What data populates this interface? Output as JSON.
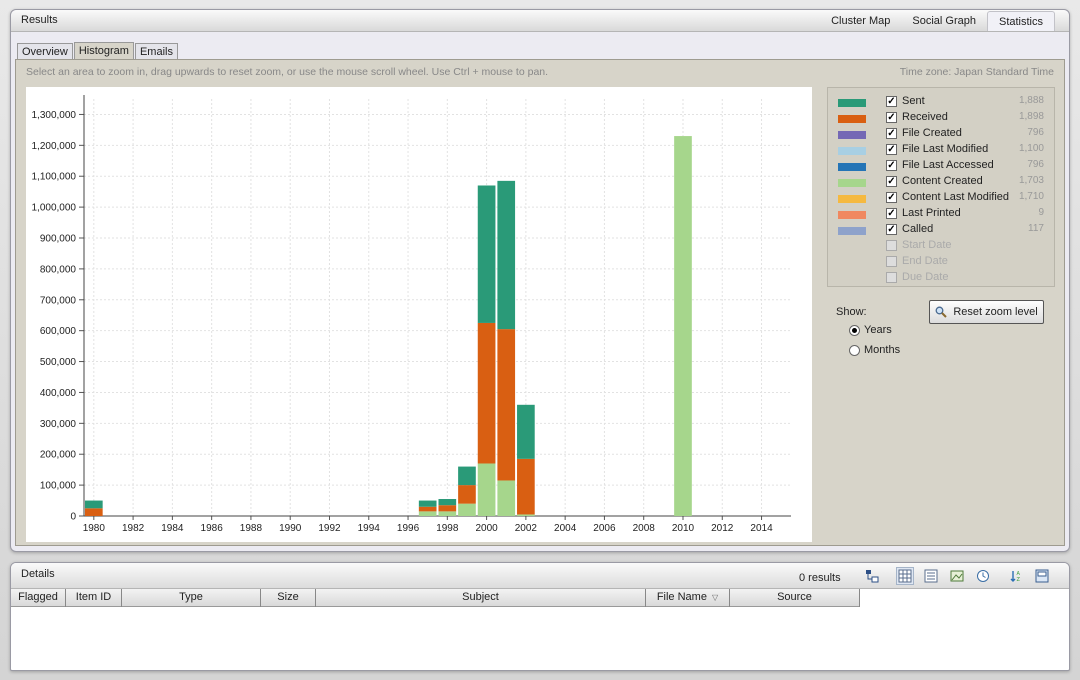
{
  "results": {
    "title": "Results",
    "top_tabs": [
      {
        "label": "Cluster Map",
        "active": false
      },
      {
        "label": "Social Graph",
        "active": false
      },
      {
        "label": "Statistics",
        "active": true
      }
    ],
    "sub_tabs": [
      {
        "label": "Overview",
        "active": false
      },
      {
        "label": "Histogram",
        "active": true
      },
      {
        "label": "Emails",
        "active": false
      }
    ],
    "hint": "Select an area to zoom in, drag upwards to reset zoom, or use the mouse scroll wheel. Use Ctrl + mouse to pan.",
    "timezone": "Time zone: Japan Standard Time"
  },
  "legend": [
    {
      "label": "Sent",
      "count": "1,888",
      "color": "#2a9a78",
      "checked": true,
      "enabled": true
    },
    {
      "label": "Received",
      "count": "1,898",
      "color": "#d95f12",
      "checked": true,
      "enabled": true
    },
    {
      "label": "File Created",
      "count": "796",
      "color": "#7468b5",
      "checked": true,
      "enabled": true
    },
    {
      "label": "File Last Modified",
      "count": "1,100",
      "color": "#a8cfe3",
      "checked": true,
      "enabled": true
    },
    {
      "label": "File Last Accessed",
      "count": "796",
      "color": "#2474b6",
      "checked": true,
      "enabled": true
    },
    {
      "label": "Content Created",
      "count": "1,703",
      "color": "#a6d68c",
      "checked": true,
      "enabled": true
    },
    {
      "label": "Content Last Modified",
      "count": "1,710",
      "color": "#f5b940",
      "checked": true,
      "enabled": true
    },
    {
      "label": "Last Printed",
      "count": "9",
      "color": "#f08860",
      "checked": true,
      "enabled": true
    },
    {
      "label": "Called",
      "count": "117",
      "color": "#8ea2cb",
      "checked": true,
      "enabled": true
    },
    {
      "label": "Start Date",
      "count": "",
      "color": "",
      "checked": false,
      "enabled": false
    },
    {
      "label": "End Date",
      "count": "",
      "color": "",
      "checked": false,
      "enabled": false
    },
    {
      "label": "Due Date",
      "count": "",
      "color": "",
      "checked": false,
      "enabled": false
    }
  ],
  "show": {
    "label": "Show:",
    "options": [
      {
        "label": "Years",
        "checked": true
      },
      {
        "label": "Months",
        "checked": false
      }
    ]
  },
  "reset_button": {
    "label": "Reset zoom level"
  },
  "chart_data": {
    "type": "bar",
    "stacked": true,
    "x_ticks": [
      "1980",
      "1982",
      "1984",
      "1986",
      "1988",
      "1990",
      "1992",
      "1994",
      "1996",
      "1998",
      "2000",
      "2002",
      "2004",
      "2006",
      "2008",
      "2010",
      "2012",
      "2014"
    ],
    "y_ticks": [
      "0",
      "100,000",
      "200,000",
      "300,000",
      "400,000",
      "500,000",
      "600,000",
      "700,000",
      "800,000",
      "900,000",
      "1,000,000",
      "1,100,000",
      "1,200,000",
      "1,300,000"
    ],
    "ylim": [
      0,
      1350000
    ],
    "xlim": [
      1979.5,
      2015.5
    ],
    "grid": true,
    "bars": [
      {
        "year": 1980,
        "segments": [
          {
            "series": "Received",
            "value": 25000,
            "color": "#d95f12"
          },
          {
            "series": "Sent",
            "value": 25000,
            "color": "#2a9a78"
          }
        ]
      },
      {
        "year": 1997,
        "segments": [
          {
            "series": "Content Created",
            "value": 15000,
            "color": "#a6d68c"
          },
          {
            "series": "Received",
            "value": 15000,
            "color": "#d95f12"
          },
          {
            "series": "Sent",
            "value": 20000,
            "color": "#2a9a78"
          }
        ]
      },
      {
        "year": 1998,
        "segments": [
          {
            "series": "Content Created",
            "value": 15000,
            "color": "#a6d68c"
          },
          {
            "series": "Received",
            "value": 20000,
            "color": "#d95f12"
          },
          {
            "series": "Sent",
            "value": 20000,
            "color": "#2a9a78"
          }
        ]
      },
      {
        "year": 1999,
        "segments": [
          {
            "series": "Content Created",
            "value": 40000,
            "color": "#a6d68c"
          },
          {
            "series": "Received",
            "value": 60000,
            "color": "#d95f12"
          },
          {
            "series": "Sent",
            "value": 60000,
            "color": "#2a9a78"
          }
        ]
      },
      {
        "year": 2000,
        "segments": [
          {
            "series": "Content Created",
            "value": 170000,
            "color": "#a6d68c"
          },
          {
            "series": "Received",
            "value": 455000,
            "color": "#d95f12"
          },
          {
            "series": "Sent",
            "value": 445000,
            "color": "#2a9a78"
          }
        ]
      },
      {
        "year": 2001,
        "segments": [
          {
            "series": "Content Created",
            "value": 115000,
            "color": "#a6d68c"
          },
          {
            "series": "Received",
            "value": 490000,
            "color": "#d95f12"
          },
          {
            "series": "Sent",
            "value": 480000,
            "color": "#2a9a78"
          }
        ]
      },
      {
        "year": 2002,
        "segments": [
          {
            "series": "Content Created",
            "value": 5000,
            "color": "#a6d68c"
          },
          {
            "series": "Received",
            "value": 180000,
            "color": "#d95f12"
          },
          {
            "series": "Sent",
            "value": 175000,
            "color": "#2a9a78"
          }
        ]
      },
      {
        "year": 2010,
        "segments": [
          {
            "series": "Content Created",
            "value": 1230000,
            "color": "#a6d68c"
          }
        ]
      }
    ]
  },
  "details": {
    "title": "Details",
    "results_count": "0 results",
    "columns": [
      "Flagged",
      "Item ID",
      "Type",
      "Size",
      "Subject",
      "File Name",
      "Source"
    ]
  }
}
